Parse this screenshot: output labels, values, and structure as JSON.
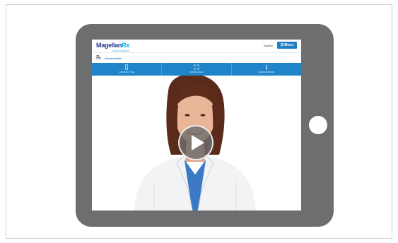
{
  "header": {
    "logo_main": "Magellan",
    "logo_rx": "Rx",
    "logo_sub": "MANAGEMENT",
    "lang_link": "Español",
    "menu_label": "Menu"
  },
  "product": {
    "rx_symbol": "℞",
    "name": "Atomoxetine"
  },
  "nav": [
    {
      "label": "CONTACT ME",
      "icon": "phone-icon"
    },
    {
      "label": "DOWNLOAD",
      "icon": "download-icon"
    },
    {
      "label": "INFORMATION",
      "icon": "info-icon"
    }
  ],
  "video": {
    "play_icon": "play-icon"
  },
  "colors": {
    "tablet": "#6d6e70",
    "brand_blue": "#1f84c9",
    "logo_navy": "#2b3990",
    "logo_cyan": "#00a0dd"
  }
}
